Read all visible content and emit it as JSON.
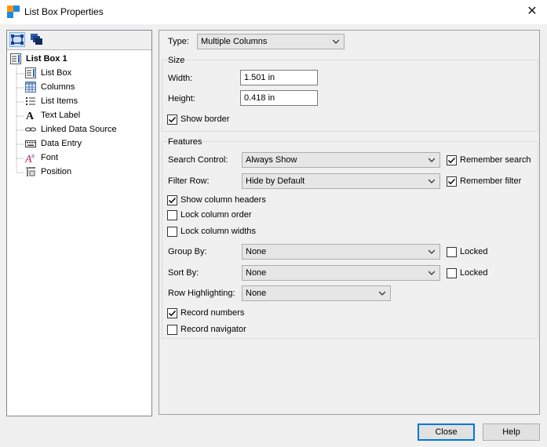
{
  "window": {
    "title": "List Box Properties",
    "close_glyph": "✕"
  },
  "tree": {
    "root": {
      "label": "List Box 1",
      "icon": "list-box-icon"
    },
    "items": [
      {
        "label": "List Box",
        "icon": "list-box-icon"
      },
      {
        "label": "Columns",
        "icon": "columns-grid-icon"
      },
      {
        "label": "List Items",
        "icon": "list-items-icon"
      },
      {
        "label": "Text Label",
        "icon": "text-label-icon"
      },
      {
        "label": "Linked Data Source",
        "icon": "link-icon"
      },
      {
        "label": "Data Entry",
        "icon": "keyboard-icon"
      },
      {
        "label": "Font",
        "icon": "font-icon"
      },
      {
        "label": "Position",
        "icon": "position-icon"
      }
    ]
  },
  "main": {
    "type_label": "Type:",
    "type_value": "Multiple Columns",
    "size": {
      "title": "Size",
      "width_label": "Width:",
      "width_value": "1.501 in",
      "height_label": "Height:",
      "height_value": "0.418 in",
      "show_border_label": "Show border",
      "show_border_checked": true
    },
    "features": {
      "title": "Features",
      "search_control_label": "Search Control:",
      "search_control_value": "Always Show",
      "remember_search_label": "Remember search",
      "remember_search_checked": true,
      "filter_row_label": "Filter Row:",
      "filter_row_value": "Hide by Default",
      "remember_filter_label": "Remember filter",
      "remember_filter_checked": true,
      "show_column_headers_label": "Show column headers",
      "show_column_headers_checked": true,
      "lock_column_order_label": "Lock column order",
      "lock_column_order_checked": false,
      "lock_column_widths_label": "Lock column widths",
      "lock_column_widths_checked": false,
      "group_by_label": "Group By:",
      "group_by_value": "None",
      "group_by_locked_label": "Locked",
      "group_by_locked_checked": false,
      "sort_by_label": "Sort By:",
      "sort_by_value": "None",
      "sort_by_locked_label": "Locked",
      "sort_by_locked_checked": false,
      "row_highlighting_label": "Row Highlighting:",
      "row_highlighting_value": "None",
      "record_numbers_label": "Record numbers",
      "record_numbers_checked": true,
      "record_navigator_label": "Record navigator",
      "record_navigator_checked": false
    }
  },
  "buttons": {
    "close_label": "Close",
    "help_label": "Help"
  },
  "colors": {
    "accent": "#0078d7",
    "selection": "#cce4f7"
  }
}
